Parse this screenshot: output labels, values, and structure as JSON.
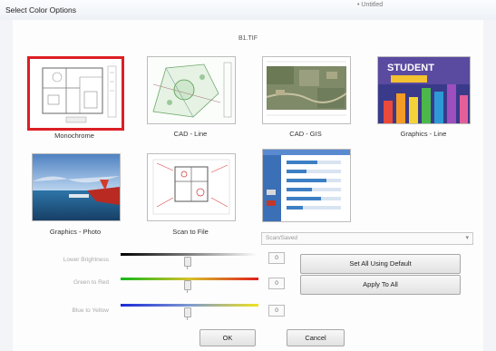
{
  "window": {
    "title": "Select Color Options",
    "title_extra": "• Untitled"
  },
  "file": {
    "name": "B1.TIF"
  },
  "thumbnails": [
    {
      "label": "Monochrome",
      "selected": true
    },
    {
      "label": "CAD - Line",
      "selected": false
    },
    {
      "label": "CAD - GIS",
      "selected": false
    },
    {
      "label": "Graphics - Line",
      "selected": false
    },
    {
      "label": "Graphics - Photo",
      "selected": false
    },
    {
      "label": "Scan to File",
      "selected": false
    },
    {
      "label": "",
      "selected": false
    }
  ],
  "thumb_texts": {
    "student_title": "STUDENT"
  },
  "dropdown": {
    "value": "Scan/Saved"
  },
  "sliders": [
    {
      "label": "Lower Brightness",
      "value": "0",
      "level": 0.5
    },
    {
      "label": "Green to Red",
      "value": "0",
      "level": 0.5
    },
    {
      "label": "Blue to Yellow",
      "value": "0",
      "level": 0.5
    }
  ],
  "buttons": {
    "set_all_default": "Set All Using Default",
    "apply_to_all": "Apply To All",
    "ok": "OK",
    "cancel": "Cancel"
  },
  "colors": {
    "selection_border": "#dd1e25"
  }
}
